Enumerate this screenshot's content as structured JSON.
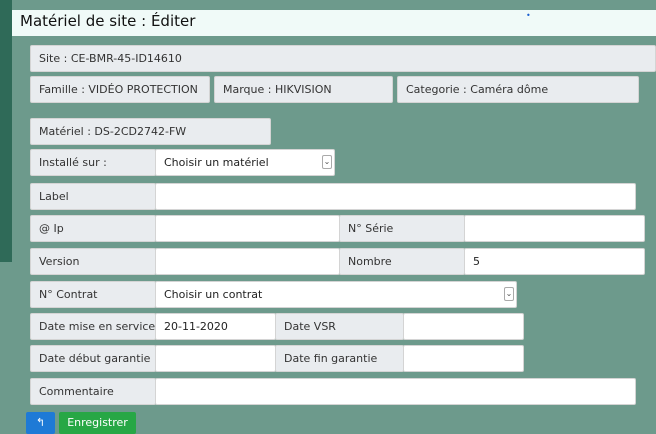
{
  "header": {
    "title": "Matériel de site : Éditer",
    "accent": "•"
  },
  "site": "Site : CE-BMR-45-ID14610",
  "famille": "Famille : VIDÉO PROTECTION",
  "marque": "Marque : HIKVISION",
  "categorie": "Categorie : Caméra dôme",
  "materiel": "Matériel : DS-2CD2742-FW",
  "fields": {
    "installe_sur": {
      "label": "Installé sur :",
      "value": "Choisir un matériel"
    },
    "label": {
      "label": "Label",
      "value": ""
    },
    "ip": {
      "label": "@ Ip",
      "value": ""
    },
    "serie": {
      "label": "N° Série",
      "value": ""
    },
    "version": {
      "label": "Version",
      "value": ""
    },
    "nombre": {
      "label": "Nombre",
      "value": "5"
    },
    "contrat": {
      "label": "N° Contrat",
      "value": "Choisir un contrat"
    },
    "date_mise_service": {
      "label": "Date mise en service",
      "value": "20-11-2020"
    },
    "date_vsr": {
      "label": "Date VSR",
      "value": ""
    },
    "date_debut_garantie": {
      "label": "Date début garantie",
      "value": ""
    },
    "date_fin_garantie": {
      "label": "Date fin garantie",
      "value": ""
    },
    "commentaire": {
      "label": "Commentaire",
      "value": ""
    }
  },
  "buttons": {
    "back_icon": "↰",
    "save": "Enregistrer"
  },
  "colors": {
    "back_button": "#1e7ad6",
    "save_button": "#27a745",
    "sidebar": "#2f6a58",
    "background": "#6d9a8c"
  }
}
